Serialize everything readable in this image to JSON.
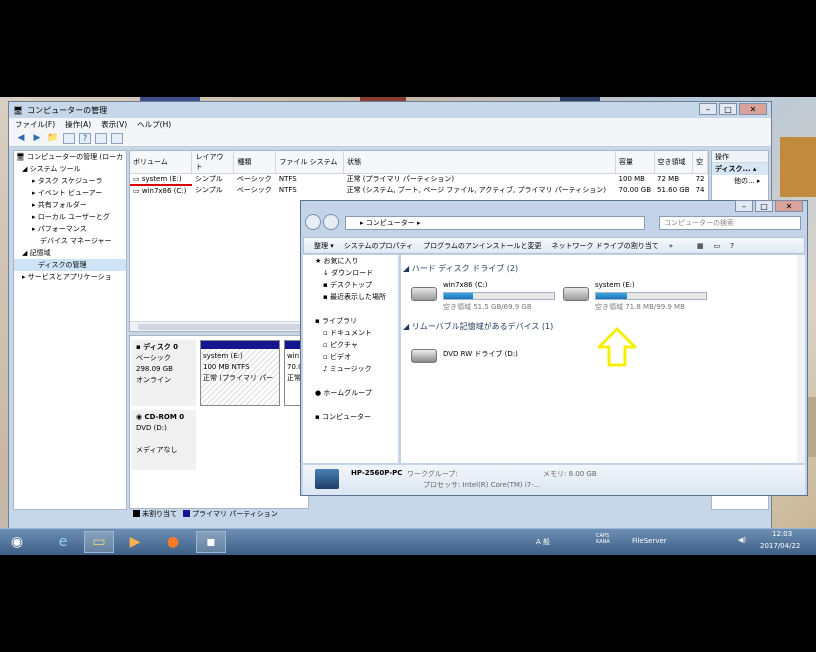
{
  "mmc": {
    "title": "コンピューターの管理",
    "menu": [
      "ファイル(F)",
      "操作(A)",
      "表示(V)",
      "ヘルプ(H)"
    ],
    "tree": [
      {
        "label": "コンピューターの管理 (ローカ",
        "indent": 0
      },
      {
        "label": "システム ツール",
        "indent": 1
      },
      {
        "label": "タスク スケジューラ",
        "indent": 2
      },
      {
        "label": "イベント ビューアー",
        "indent": 2
      },
      {
        "label": "共有フォルダー",
        "indent": 2
      },
      {
        "label": "ローカル ユーザーとグ",
        "indent": 2
      },
      {
        "label": "パフォーマンス",
        "indent": 2
      },
      {
        "label": "デバイス マネージャー",
        "indent": 2
      },
      {
        "label": "記憶域",
        "indent": 1
      },
      {
        "label": "ディスクの管理",
        "indent": 2
      },
      {
        "label": "サービスとアプリケーショ",
        "indent": 1
      }
    ],
    "columns": [
      "ボリューム",
      "レイアウト",
      "種類",
      "ファイル システム",
      "状態",
      "容量",
      "空き領域",
      "空"
    ],
    "rows": [
      [
        "system (E:)",
        "シンプル",
        "ベーシック",
        "NTFS",
        "正常 (プライマリ パーティション)",
        "100 MB",
        "72 MB",
        "72"
      ],
      [
        "win7x86 (C:)",
        "シンプル",
        "ベーシック",
        "NTFS",
        "正常 (システム, ブート, ページ ファイル, アクティブ, プライマリ パーティション)",
        "70.00 GB",
        "51.60 GB",
        "74"
      ]
    ],
    "ops_header": "操作",
    "ops_item1": "ディスク...",
    "ops_item2": "他の...",
    "disk0": {
      "name": "ディスク 0",
      "type": "ベーシック",
      "size": "298.09 GB",
      "state": "オンライン"
    },
    "part1": {
      "name": "system (E:)",
      "info": "100 MB NTFS",
      "state": "正常 (プライマリ パー"
    },
    "part2": {
      "name": "win7",
      "info": "70.0",
      "state": "正常"
    },
    "cdrom": {
      "name": "CD-ROM 0",
      "drive": "DVD (D:)",
      "media": "メディアなし"
    },
    "legend": [
      "未割り当て",
      "プライマリ パーティション"
    ]
  },
  "explorer": {
    "address": "コンピューター",
    "search_placeholder": "コンピューターの検索",
    "commands": [
      "整理 ▾",
      "システムのプロパティ",
      "プログラムのアンインストールと変更",
      "ネットワーク ドライブの割り当て",
      "»"
    ],
    "nav": [
      "お気に入り",
      "ダウンロード",
      "デスクトップ",
      "最近表示した場所",
      "",
      "ライブラリ",
      "ドキュメント",
      "ピクチャ",
      "ビデオ",
      "ミュージック",
      "",
      "ホームグループ",
      "",
      "コンピューター"
    ],
    "group_hdd": "ハード ディスク ドライブ (2)",
    "group_removable": "リムーバブル記憶域があるデバイス (1)",
    "drives": [
      {
        "name": "win7x86 (C:)",
        "free": "空き領域 51.5 GB/69.9 GB",
        "used_fraction": 0.26
      },
      {
        "name": "system (E:)",
        "free": "空き領域 71.8 MB/99.9 MB",
        "used_fraction": 0.28
      }
    ],
    "dvd": "DVD RW ドライブ (D:)",
    "status": {
      "pc": "HP-2560P-PC",
      "workgroup_label": "ワークグループ:",
      "memory_label": "メモリ: 8.00 GB",
      "processor": "プロセッサ: Intel(R) Core(TM) i7-..."
    }
  },
  "taskbar": {
    "fileserver": "FileServer",
    "time": "12:03",
    "date": "2017/04/22",
    "caps": "CAPS KANA",
    "ime": "A 般"
  },
  "colors": {
    "accent": "#14168f",
    "highlight_arrow": "#f3f000"
  }
}
